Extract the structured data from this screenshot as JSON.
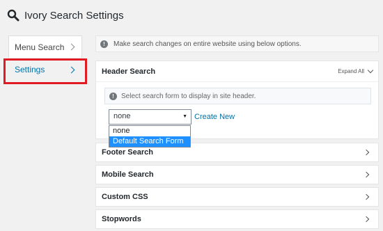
{
  "page": {
    "title": "Ivory Search Settings"
  },
  "tabs": [
    {
      "label": "Menu Search"
    },
    {
      "label": "Settings"
    }
  ],
  "notice": "Make search changes on entire website using below options.",
  "header_search": {
    "title": "Header Search",
    "expand_label": "Expand All",
    "notice": "Select search form to display in site header.",
    "select_value": "none",
    "create_new": "Create New",
    "options": [
      "none",
      "Default Search Form"
    ]
  },
  "panels": [
    {
      "label": "Footer Search"
    },
    {
      "label": "Mobile Search"
    },
    {
      "label": "Custom CSS"
    },
    {
      "label": "Stopwords"
    }
  ],
  "icons": {
    "title": "search-icon",
    "info": "info-icon",
    "chevron": "chevron-right-icon"
  },
  "colors": {
    "accent": "#0073aa",
    "highlight": "#e01b23",
    "selected_option": "#1e90ff"
  }
}
